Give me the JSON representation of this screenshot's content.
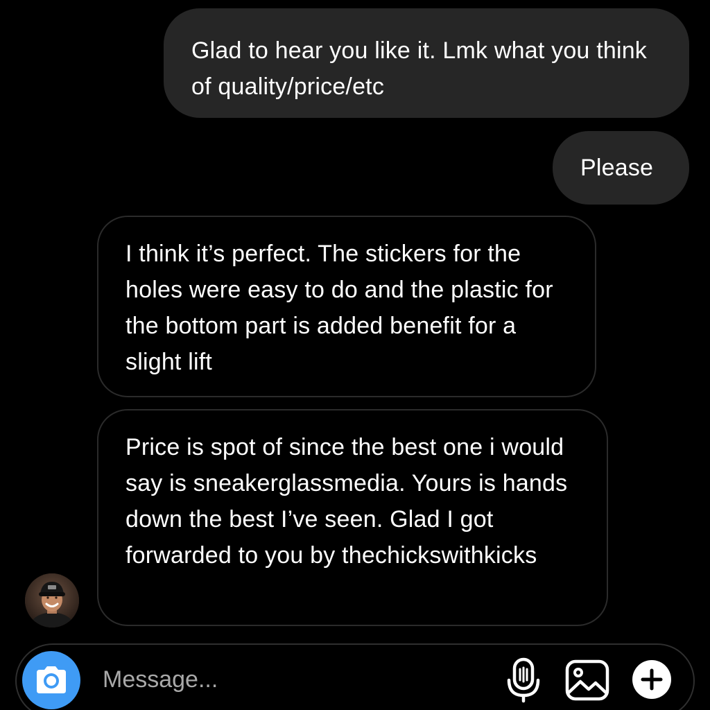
{
  "conversation": {
    "messages": [
      {
        "direction": "sent",
        "text": "Glad to hear you like it. Lmk what you think of quality/price/etc"
      },
      {
        "direction": "sent",
        "text": "Please"
      },
      {
        "direction": "received",
        "text": "I think it’s perfect. The stickers for the holes were easy to do and the plastic for the bottom part is added benefit for a slight lift"
      },
      {
        "direction": "received",
        "text": "Price is spot of since the best one i would say is sneakerglassmedia. Yours is hands down the best I’ve seen. Glad I got forwarded to you by thechickswithkicks"
      }
    ]
  },
  "composer": {
    "placeholder": "Message...",
    "icons": {
      "camera": "camera-icon",
      "microphone": "microphone-icon",
      "gallery": "gallery-icon",
      "add": "plus-icon"
    },
    "camera_color": "#3f9bf5"
  },
  "colors": {
    "background": "#000000",
    "sent_bubble": "#262626",
    "received_border": "#2b2b2b",
    "text": "#ffffff",
    "placeholder": "#a9a9a9"
  }
}
